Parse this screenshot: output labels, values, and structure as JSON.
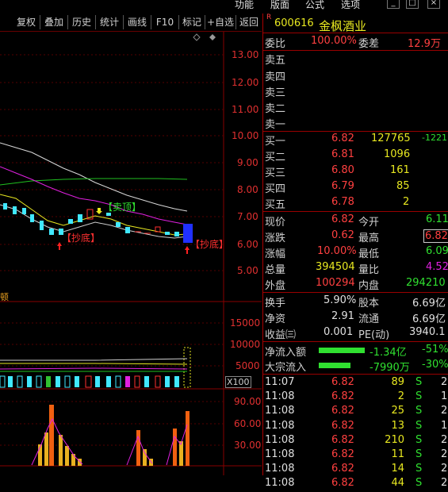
{
  "menu": {
    "items": [
      "功能",
      "版面",
      "公式",
      "选项"
    ],
    "win_buttons": [
      "_",
      "□",
      "×"
    ]
  },
  "toolbar": {
    "buttons": [
      "复权",
      "叠加",
      "历史",
      "统计",
      "画线",
      "F10",
      "标记",
      "+自选",
      "返回"
    ]
  },
  "chart": {
    "price_axis": [
      "13.00",
      "12.00",
      "11.00",
      "10.00",
      "9.00",
      "8.00",
      "7.00",
      "6.00",
      "5.00"
    ],
    "volume_axis": [
      "15000",
      "10000",
      "5000"
    ],
    "volume_unit": "X100",
    "indicator_axis": [
      "90.00",
      "60.00",
      "30.00"
    ],
    "annotations": {
      "sell_top": "【卖顶】",
      "bottom1": "【抄底】",
      "bottom2": "【抄底】",
      "side": "顿"
    },
    "colors": {
      "up": "#ff3030",
      "down": "#40e8ff",
      "ma_white": "#d8d8d8",
      "ma_yellow": "#e8e820",
      "ma_magenta": "#e020e0",
      "ma_green": "#20c020"
    }
  },
  "stock": {
    "marker": "R",
    "code": "600616",
    "name": "金枫酒业"
  },
  "order_ratio": {
    "label": "委比",
    "value": "100.00%",
    "diff_label": "委差",
    "diff_value": "12.9万"
  },
  "sells": [
    {
      "label": "卖五"
    },
    {
      "label": "卖四"
    },
    {
      "label": "卖三"
    },
    {
      "label": "卖二"
    },
    {
      "label": "卖一"
    }
  ],
  "buys": [
    {
      "label": "买一",
      "price": "6.82",
      "vol": "127765",
      "chg": "-1221"
    },
    {
      "label": "买二",
      "price": "6.81",
      "vol": "1096",
      "chg": ""
    },
    {
      "label": "买三",
      "price": "6.80",
      "vol": "161",
      "chg": ""
    },
    {
      "label": "买四",
      "price": "6.79",
      "vol": "85",
      "chg": ""
    },
    {
      "label": "买五",
      "price": "6.78",
      "vol": "2",
      "chg": ""
    }
  ],
  "quote": [
    {
      "l1": "现价",
      "v1": "6.82",
      "l2": "今开",
      "v2": "6.11",
      "c1": "v-red",
      "c2": "v-green"
    },
    {
      "l1": "涨跌",
      "v1": "0.62",
      "l2": "最高",
      "v2": "6.82",
      "c1": "v-red",
      "c2": "v-red"
    },
    {
      "l1": "涨幅",
      "v1": "10.00%",
      "l2": "最低",
      "v2": "6.09",
      "c1": "v-red",
      "c2": "v-green"
    },
    {
      "l1": "总量",
      "v1": "394504",
      "l2": "量比",
      "v2": "4.52",
      "c1": "v-yellow",
      "c2": "v-magenta"
    },
    {
      "l1": "外盘",
      "v1": "100294",
      "l2": "内盘",
      "v2": "294210",
      "c1": "v-red",
      "c2": "v-green"
    }
  ],
  "finance": [
    {
      "l1": "换手",
      "v1": "5.90%",
      "l2": "股本",
      "v2": "6.69亿"
    },
    {
      "l1": "净资",
      "v1": "2.91",
      "l2": "流通",
      "v2": "6.69亿"
    },
    {
      "l1": "收益㈢",
      "v1": "0.001",
      "l2": "PE(动)",
      "v2": "3940.1"
    }
  ],
  "flow": [
    {
      "label": "净流入额",
      "value": "-1.34亿",
      "pct": "-51%"
    },
    {
      "label": "大宗流入",
      "value": "-7990万",
      "pct": "-30%"
    }
  ],
  "ticks": [
    {
      "time": "11:07",
      "price": "6.82",
      "vol": "89",
      "dir": "S",
      "n": "2"
    },
    {
      "time": "11:08",
      "price": "6.82",
      "vol": "2",
      "dir": "S",
      "n": "1"
    },
    {
      "time": "11:08",
      "price": "6.82",
      "vol": "25",
      "dir": "S",
      "n": "2"
    },
    {
      "time": "11:08",
      "price": "6.82",
      "vol": "13",
      "dir": "S",
      "n": "1"
    },
    {
      "time": "11:08",
      "price": "6.82",
      "vol": "210",
      "dir": "S",
      "n": "2"
    },
    {
      "time": "11:08",
      "price": "6.82",
      "vol": "11",
      "dir": "S",
      "n": "2"
    },
    {
      "time": "11:08",
      "price": "6.82",
      "vol": "14",
      "dir": "S",
      "n": "2"
    },
    {
      "time": "11:08",
      "price": "6.82",
      "vol": "44",
      "dir": "S",
      "n": "2"
    }
  ]
}
